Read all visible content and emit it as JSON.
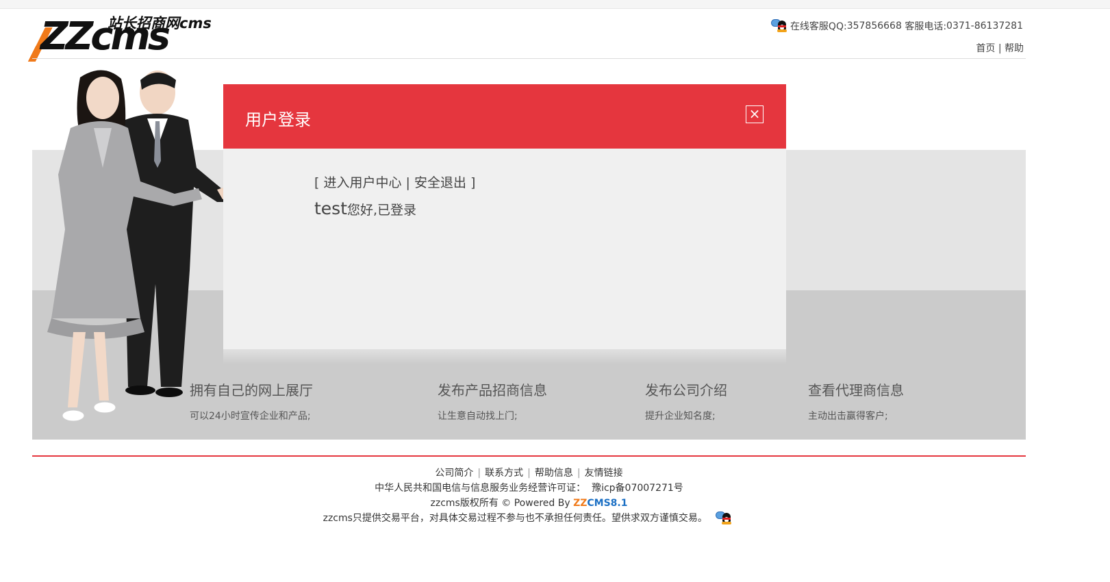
{
  "header": {
    "logo_text": "ZZcms",
    "logo_subtitle": "站长招商网cms",
    "contact_prefix": "在线客服QQ:",
    "contact_qq": "357856668",
    "contact_phone_label": " 客服电话:",
    "contact_phone": "0371-86137281",
    "nav_home": "首页",
    "nav_sep": " | ",
    "nav_help": "帮助"
  },
  "features": [
    {
      "title": "拥有自己的网上展厅",
      "desc": "可以24小时宣传企业和产品;"
    },
    {
      "title": "发布产品招商信息",
      "desc": "让生意自动找上门;"
    },
    {
      "title": "发布公司介绍",
      "desc": "提升企业知名度;"
    },
    {
      "title": "查看代理商信息",
      "desc": "主动出击赢得客户;"
    }
  ],
  "modal": {
    "title": "用户登录",
    "close_label": "×",
    "link_open": "[ ",
    "link_user_center": "进入用户中心",
    "link_sep": " | ",
    "link_logout": "安全退出",
    "link_close": " ]",
    "username": "test",
    "greeting": "您好,已登录"
  },
  "footer": {
    "links": [
      "公司简介",
      "联系方式",
      "帮助信息",
      "友情链接"
    ],
    "sep": "|",
    "license": "中华人民共和国电信与信息服务业务经营许可证：  豫icp备07007271号",
    "copyright_prefix": "zzcms版权所有 © Powered By ",
    "powered_zz": "ZZ",
    "powered_cms": "CMS8.1",
    "disclaimer": "zzcms只提供交易平台，对具体交易过程不参与也不承担任何责任。望供求双方谨慎交易。"
  },
  "colors": {
    "accent_red": "#e5363e",
    "brand_orange": "#f07a1a",
    "brand_blue": "#1a6fc4"
  },
  "icons": [
    "qq-icon",
    "close-icon",
    "people-illustration"
  ]
}
